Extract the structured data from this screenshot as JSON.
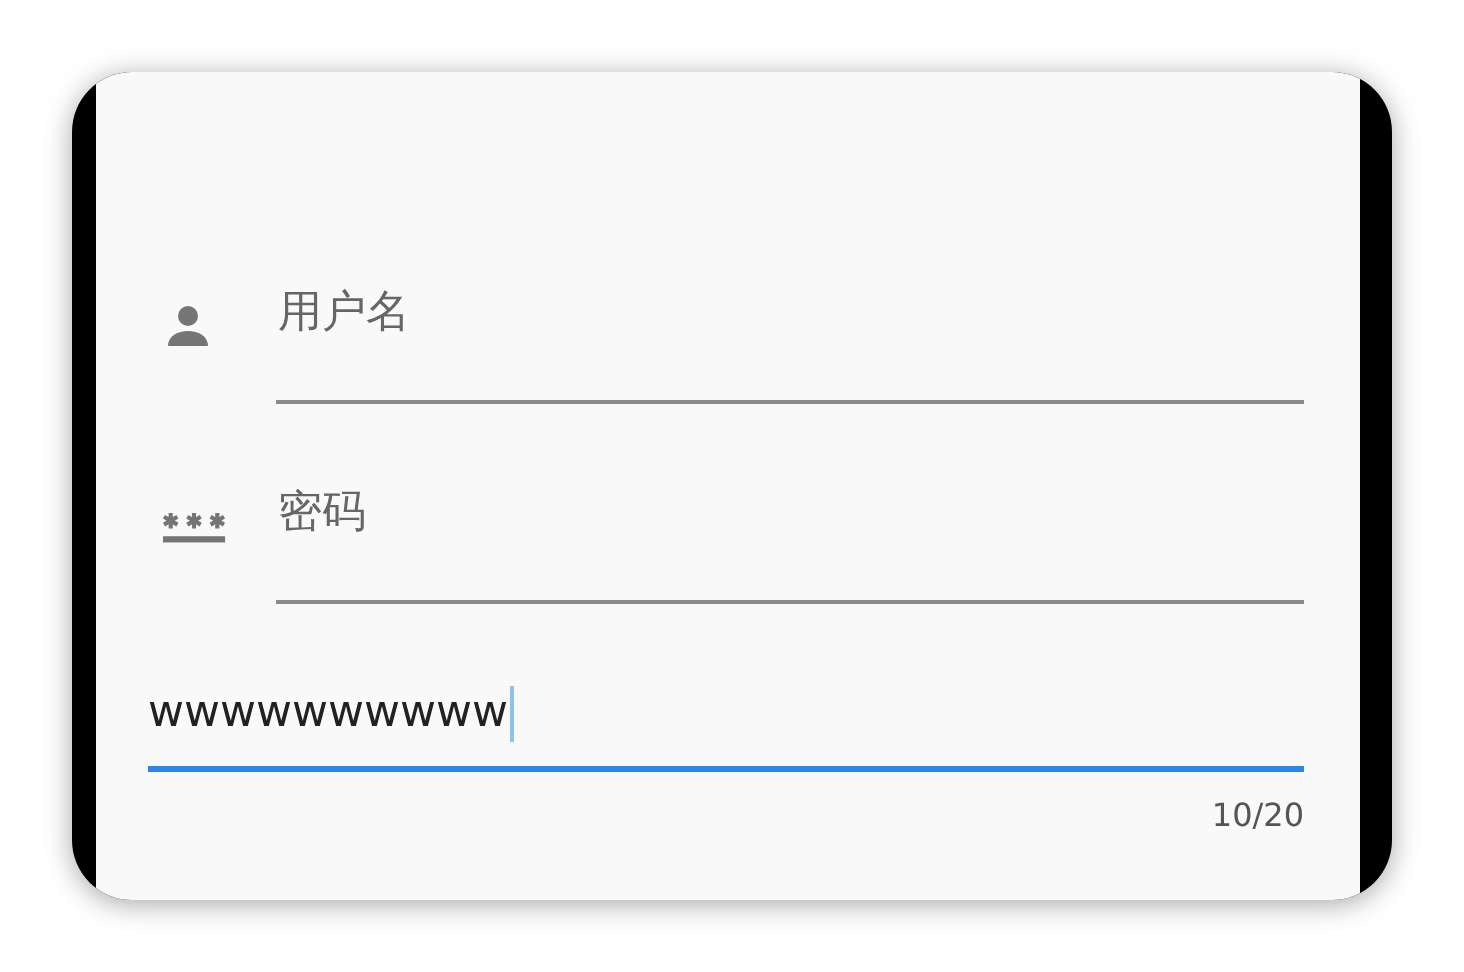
{
  "fields": [
    {
      "kind": "user",
      "placeholder": "用户名",
      "focused": false
    },
    {
      "kind": "password",
      "placeholder": "密码",
      "focused": false
    },
    {
      "kind": "plain",
      "value": "wwwwwwwwww",
      "focused": true,
      "counter": "10/20"
    }
  ]
}
